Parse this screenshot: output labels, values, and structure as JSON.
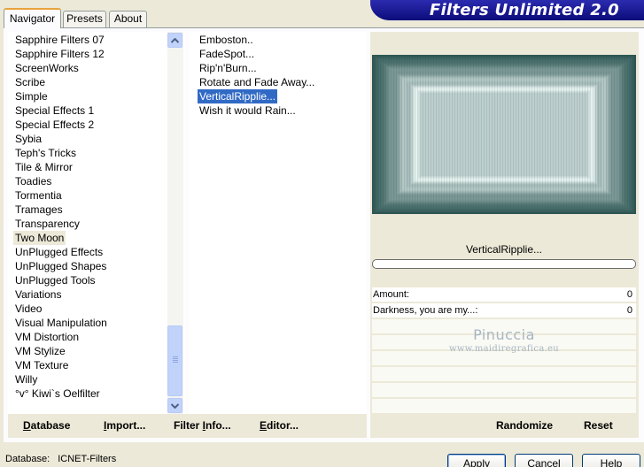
{
  "tabs": [
    {
      "label": "Navigator",
      "active": true
    },
    {
      "label": "Presets",
      "active": false
    },
    {
      "label": "About",
      "active": false
    }
  ],
  "app_title": "Filters Unlimited 2.0",
  "categories": [
    "Sapphire Filters 07",
    "Sapphire Filters 12",
    "ScreenWorks",
    "Scribe",
    "Simple",
    "Special Effects 1",
    "Special Effects 2",
    "Sybia",
    "Teph's Tricks",
    "Tile & Mirror",
    "Toadies",
    "Tormentia",
    "Tramages",
    "Transparency",
    "Two Moon",
    "UnPlugged Effects",
    "UnPlugged Shapes",
    "UnPlugged Tools",
    "Variations",
    "Video",
    "Visual Manipulation",
    "VM Distortion",
    "VM Stylize",
    "VM Texture",
    "Willy",
    "°v° Kiwi`s Oelfilter"
  ],
  "selected_category": "Two Moon",
  "filters": [
    "Emboston..",
    "FadeSpot...",
    "Rip'n'Burn...",
    "Rotate and Fade Away...",
    "VerticalRipplie...",
    "Wish it would Rain..."
  ],
  "selected_filter": "VerticalRipplie...",
  "current_filter_name": "VerticalRipplie...",
  "params": [
    {
      "label": "Amount:",
      "value": "0"
    },
    {
      "label": "Darkness, you are my...:",
      "value": "0"
    }
  ],
  "watermark": {
    "title": "Pinuccia",
    "url": "www.maidiregrafica.eu"
  },
  "buttons": {
    "database": {
      "underline": "D",
      "rest": "atabase"
    },
    "import": {
      "underline": "I",
      "rest": "mport..."
    },
    "filter_info": {
      "before": "Filter ",
      "underline": "I",
      "rest": "nfo..."
    },
    "editor": {
      "underline": "E",
      "rest": "ditor..."
    },
    "randomize": "Randomize",
    "reset": "Reset"
  },
  "status": {
    "database_label": "Database:",
    "database_value": "ICNET-Filters"
  },
  "dialog_buttons": {
    "apply": "Apply",
    "cancel": "Cancel",
    "help": "Help"
  },
  "colors": {
    "banner": "#1a1a8c",
    "selection": "#316ac5",
    "scrollbar": "#c1d3fb",
    "preview_dark": "#2e5754",
    "preview_light": "#e9f4f2"
  },
  "icons": [
    "scroll-up-icon",
    "scroll-down-icon"
  ]
}
